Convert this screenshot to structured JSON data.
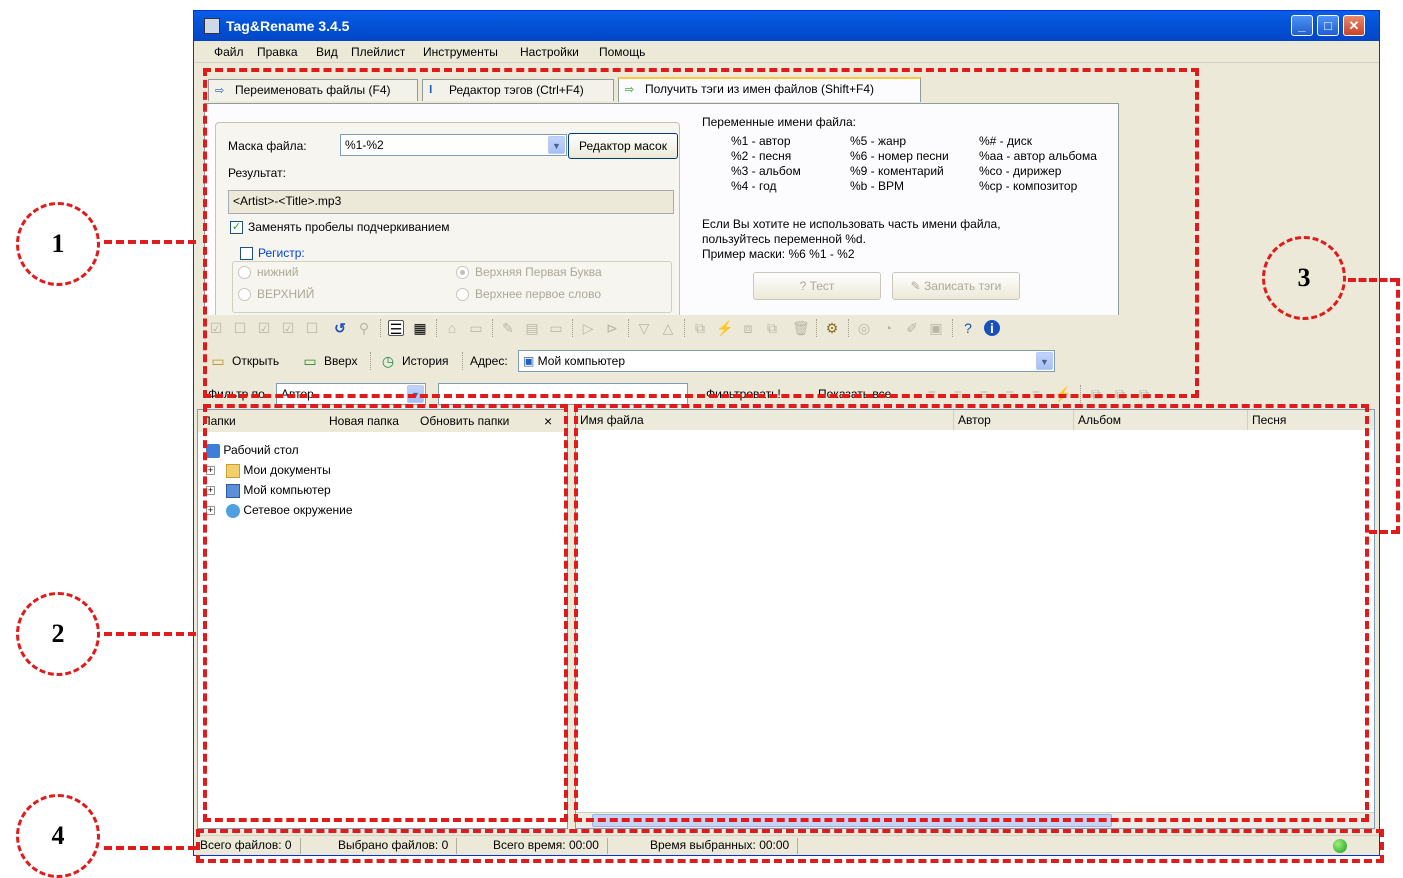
{
  "window": {
    "title": "Tag&Rename 3.4.5"
  },
  "menu": [
    "Файл",
    "Правка",
    "Вид",
    "Плейлист",
    "Инструменты",
    "Настройки",
    "Помощь"
  ],
  "tabs": [
    {
      "label": "Переименовать файлы (F4)"
    },
    {
      "label": "Редактор тэгов (Ctrl+F4)"
    },
    {
      "label": "Получить тэги из имен файлов (Shift+F4)"
    }
  ],
  "form": {
    "mask_label": "Маска файла:",
    "mask_value": "%1-%2",
    "mask_editor_button": "Редактор масок",
    "result_label": "Результат:",
    "result_value": "<Artist>-<Title>.mp3",
    "replace_spaces": "Заменять пробелы подчеркиванием",
    "case_label": "Регистр:",
    "case_lower": "нижний",
    "case_upper": "ВЕРХНИЙ",
    "case_title": "Верхняя Первая Буква",
    "case_sentence": "Верхнее первое слово"
  },
  "vars": {
    "heading": "Переменные имени файла:",
    "col1": [
      "%1 - автор",
      "%2 - песня",
      "%3 - альбом",
      "%4 - год"
    ],
    "col2": [
      "%5 - жанр",
      "%6 - номер песни",
      "%9 - коментарий",
      "%b - BPM"
    ],
    "col3": [
      "%# - диск",
      "%aa - автор альбома",
      "%co - дирижер",
      "%cp - композитор"
    ],
    "note1": "Если Вы хотите не использовать часть имени файла,",
    "note2": "пользуйтесь переменной %d.",
    "note3": "Пример маски: %6 %1 - %2",
    "test_button": "Тест",
    "write_button": "Записать тэги"
  },
  "nav": {
    "open": "Открыть",
    "up": "Вверх",
    "history": "История",
    "address_label": "Адрес:",
    "address_value": "Мой компьютер"
  },
  "filter": {
    "label": "Фильтр по",
    "field": "Автор",
    "apply": "Фильтровать!",
    "show_all": "Показать все"
  },
  "folders": {
    "title": "Папки",
    "new_folder": "Новая папка",
    "refresh": "Обновить папки",
    "items": [
      "Рабочий стол",
      "Мои документы",
      "Мой компьютер",
      "Сетевое окружение"
    ]
  },
  "files": {
    "columns": [
      "Имя файла",
      "Автор",
      "Альбом",
      "Песня"
    ]
  },
  "status": {
    "total_files": "Всего файлов: 0",
    "selected_files": "Выбрано файлов: 0",
    "total_time": "Всего время: 00:00",
    "selected_time": "Время выбранных: 00:00"
  },
  "annotations": [
    "1",
    "2",
    "3",
    "4"
  ]
}
